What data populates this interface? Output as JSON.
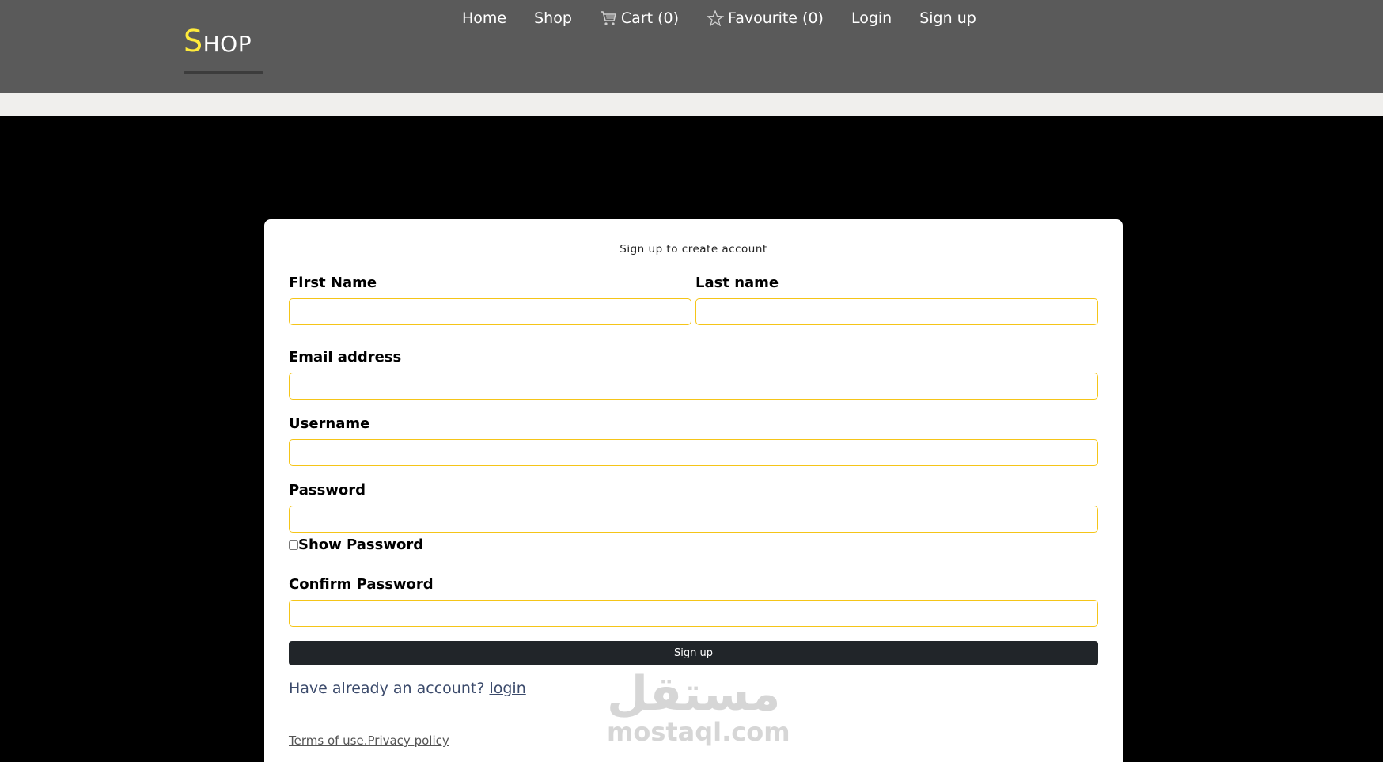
{
  "header": {
    "logo_first": "S",
    "logo_rest": "HOP",
    "nav": [
      {
        "label": "Home",
        "icon": null
      },
      {
        "label": "Shop",
        "icon": null
      },
      {
        "label": "Cart (0)",
        "icon": "cart-icon"
      },
      {
        "label": "Favourite (0)",
        "icon": "star-icon"
      },
      {
        "label": "Login",
        "icon": null
      },
      {
        "label": "Sign up",
        "icon": null
      }
    ]
  },
  "form": {
    "title": "Sign up to create account",
    "first_name_label": "First Name",
    "last_name_label": "Last name",
    "email_label": "Email address",
    "username_label": "Username",
    "password_label": "Password",
    "show_password_label": "Show Password",
    "confirm_password_label": "Confirm Password",
    "submit_label": "Sign up",
    "have_account_text": "Have already an account?",
    "login_link": "login",
    "terms_text": "Terms of use.",
    "privacy_text": "Privacy policy"
  },
  "watermark": {
    "arabic": "مستقل",
    "latin": "mostaql.com"
  },
  "colors": {
    "header_bg": "#5a5a5a",
    "logo_accent": "#ffeb3b",
    "input_border": "#f5c518",
    "button_bg": "#212529",
    "page_bg": "#000000"
  }
}
